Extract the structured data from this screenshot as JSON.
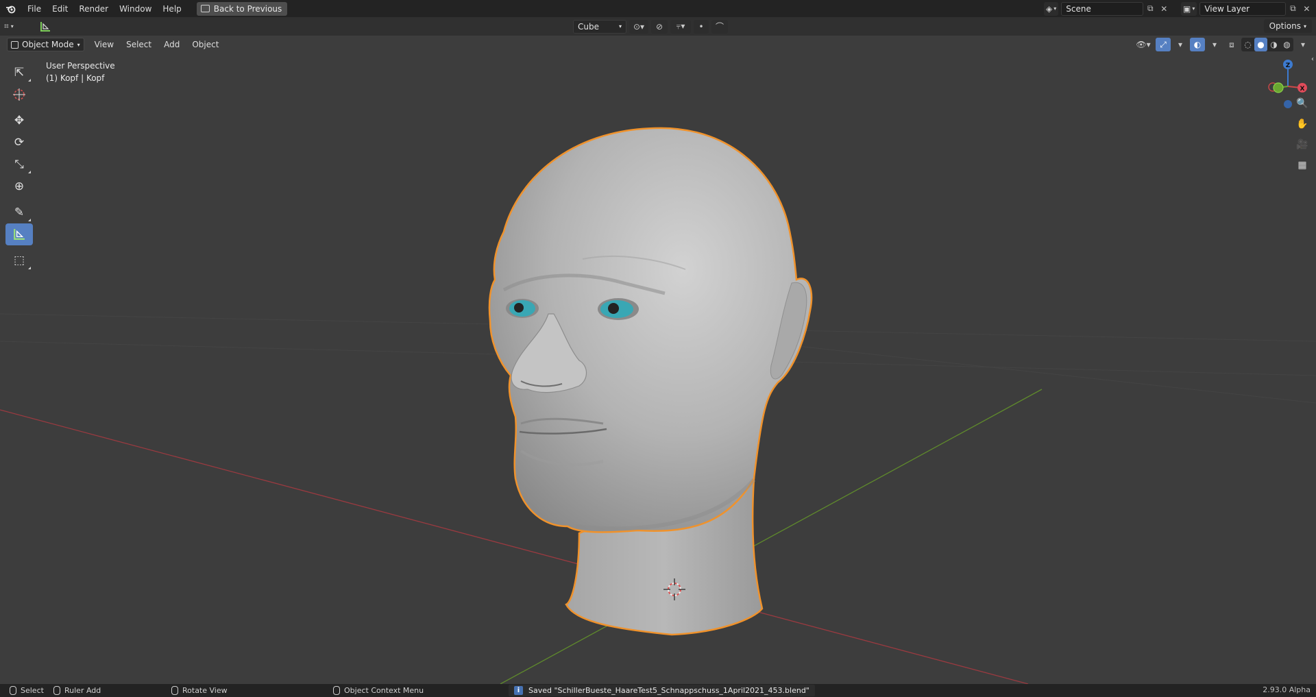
{
  "topbar": {
    "menus": [
      "File",
      "Edit",
      "Render",
      "Window",
      "Help"
    ],
    "back_label": "Back to Previous",
    "scene_value": "Scene",
    "view_layer_value": "View Layer"
  },
  "tool_header": {
    "snap_target": "Cube",
    "options_label": "Options"
  },
  "viewport_header": {
    "mode": "Object Mode",
    "menus": [
      "View",
      "Select",
      "Add",
      "Object"
    ]
  },
  "viewport": {
    "perspective_label": "User Perspective",
    "object_label": "(1) Kopf | Kopf",
    "gizmo": {
      "z_label": "Z",
      "x_label": "X"
    }
  },
  "toolbar": {
    "tools": [
      "select-box",
      "cursor",
      "move",
      "rotate",
      "scale",
      "transform",
      "annotate",
      "measure",
      "add-cube"
    ],
    "active_tool": "measure"
  },
  "statusbar": {
    "select_label": "Select",
    "ruler_add_label": "Ruler Add",
    "rotate_view_label": "Rotate View",
    "context_menu_label": "Object Context Menu",
    "saved_message": "Saved \"SchillerBueste_HaareTest5_Schnappschuss_1April2021_453.blend\"",
    "version": "2.93.0 Alpha"
  },
  "colors": {
    "accent": "#5680c2",
    "selection_outline": "#f0922b",
    "x_axis": "#b0363f",
    "y_axis": "#6d9a2f",
    "viewport_bg": "#3d3d3d"
  }
}
